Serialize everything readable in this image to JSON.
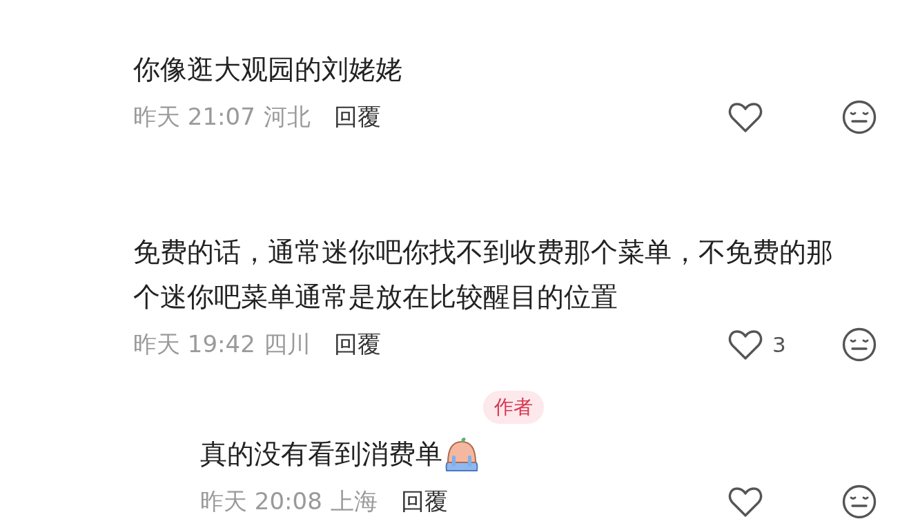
{
  "comments": [
    {
      "text": "你像逛大观园的刘姥姥",
      "time": "昨天 21:07",
      "location": "河北",
      "reply_label": "回覆"
    },
    {
      "text": "免费的话，通常迷你吧你找不到收费那个菜单，不免费的那个迷你吧菜单通常是放在比较醒目的位置",
      "time": "昨天 19:42",
      "location": "四川",
      "reply_label": "回覆",
      "likes": "3",
      "children": [
        {
          "badge": "作者",
          "text": "真的没有看到消费单",
          "sticker": true,
          "time": "昨天 20:08",
          "location": "上海",
          "reply_label": "回覆"
        }
      ]
    }
  ]
}
